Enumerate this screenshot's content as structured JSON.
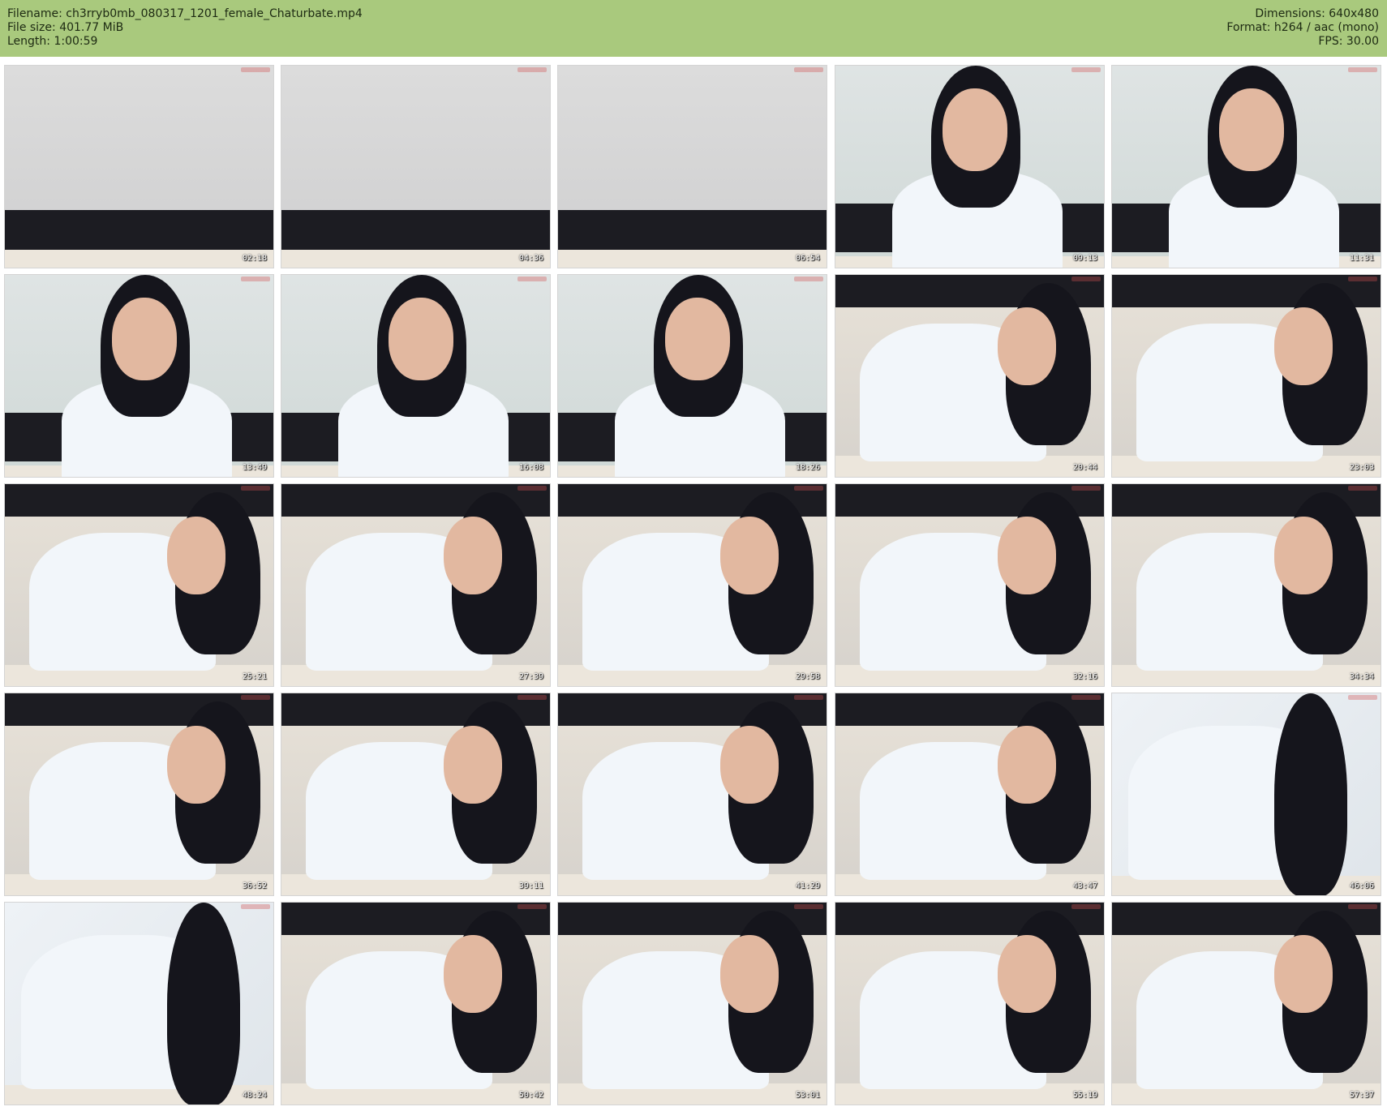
{
  "header": {
    "filename": "Filename: ch3rryb0mb_080317_1201_female_Chaturbate.mp4",
    "filesize": "File size: 401.77 MiB",
    "length": "Length: 1:00:59",
    "dimensions": "Dimensions: 640x480",
    "format": "Format: h264 / aac (mono)",
    "fps": "FPS: 30.00"
  },
  "thumbnails": [
    {
      "time": "02:18",
      "scene": "empty"
    },
    {
      "time": "04:36",
      "scene": "empty"
    },
    {
      "time": "06:54",
      "scene": "empty"
    },
    {
      "time": "09:13",
      "scene": "seated"
    },
    {
      "time": "11:31",
      "scene": "seated"
    },
    {
      "time": "13:49",
      "scene": "seated"
    },
    {
      "time": "16:08",
      "scene": "seated"
    },
    {
      "time": "18:26",
      "scene": "seated"
    },
    {
      "time": "20:44",
      "scene": "lying"
    },
    {
      "time": "23:03",
      "scene": "lying"
    },
    {
      "time": "25:21",
      "scene": "lying"
    },
    {
      "time": "27:39",
      "scene": "lying"
    },
    {
      "time": "29:58",
      "scene": "lying"
    },
    {
      "time": "32:16",
      "scene": "lying"
    },
    {
      "time": "34:34",
      "scene": "lying"
    },
    {
      "time": "36:52",
      "scene": "lying"
    },
    {
      "time": "39:11",
      "scene": "lying"
    },
    {
      "time": "41:29",
      "scene": "lying"
    },
    {
      "time": "43:47",
      "scene": "lying"
    },
    {
      "time": "46:06",
      "scene": "closeup"
    },
    {
      "time": "48:24",
      "scene": "closeup"
    },
    {
      "time": "50:42",
      "scene": "lying"
    },
    {
      "time": "53:01",
      "scene": "lying"
    },
    {
      "time": "55:19",
      "scene": "lying"
    },
    {
      "time": "57:37",
      "scene": "lying"
    }
  ],
  "colors": {
    "header_bg": "#a9c97d",
    "wall": "#d9dcdc",
    "headboard": "#1c1c22",
    "bed": "#ece6dc",
    "shirt": "#f2f6fa"
  }
}
